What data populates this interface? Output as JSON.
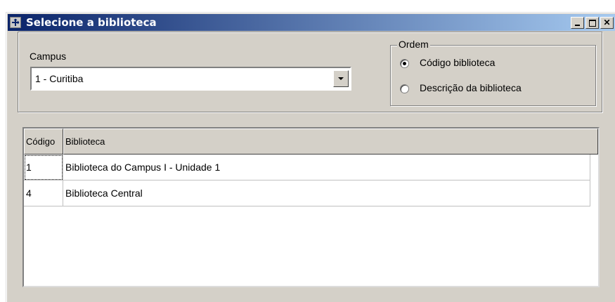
{
  "window": {
    "title": "Selecione a biblioteca"
  },
  "campus": {
    "label": "Campus",
    "selected": "1 - Curitiba"
  },
  "ordem": {
    "label": "Ordem",
    "options": [
      {
        "label": "Código biblioteca",
        "checked": true
      },
      {
        "label": "Descrição da biblioteca",
        "checked": false
      }
    ]
  },
  "grid": {
    "columns": [
      "Código",
      "Biblioteca"
    ],
    "rows": [
      {
        "codigo": "1",
        "biblioteca": "Biblioteca do Campus I - Unidade 1"
      },
      {
        "codigo": "4",
        "biblioteca": "Biblioteca Central"
      }
    ]
  }
}
